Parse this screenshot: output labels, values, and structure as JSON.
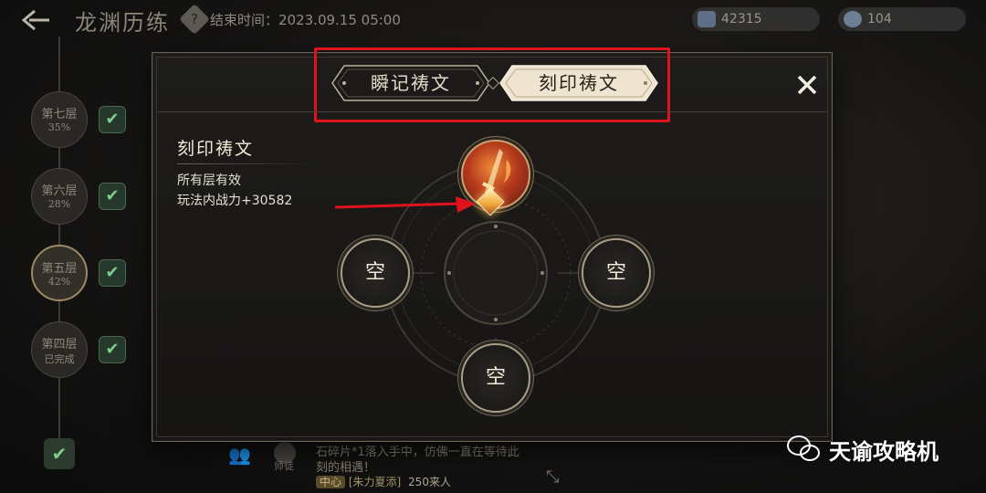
{
  "topbar": {
    "back_icon": "back-arrow-icon",
    "title": "龙渊历练",
    "help_icon": "?",
    "end_time": "结束时间：2023.09.15 05:00",
    "resources": [
      {
        "icon": "ticket-icon",
        "value": "42315"
      },
      {
        "icon": "orb-icon",
        "value": "104"
      }
    ]
  },
  "floors": [
    {
      "name": "第七层",
      "progress": "35%"
    },
    {
      "name": "第六层",
      "progress": "28%"
    },
    {
      "name": "第五层",
      "progress": "42%"
    },
    {
      "name": "第四层",
      "progress": "已完成"
    }
  ],
  "bottom": {
    "note_line1": "石碎片*1落入手中，仿佛一直在等待此",
    "note_line2": "刻的相遇！",
    "cert_label": "师徒",
    "chip": "中心",
    "chip_user": "[朱力夏添]",
    "count": "250来人"
  },
  "modal": {
    "tabs": [
      {
        "label": "瞬记祷文",
        "selected": false
      },
      {
        "label": "刻印祷文",
        "selected": true
      }
    ],
    "close_icon": "✕",
    "info": {
      "title": "刻印祷文",
      "line1": "所有层有效",
      "line2": "玩法内战力+30582"
    },
    "slots": {
      "top": {
        "state": "filled",
        "icon": "flame-sword-rune-icon"
      },
      "left": {
        "label": "空"
      },
      "right": {
        "label": "空"
      },
      "bottom": {
        "label": "空"
      }
    }
  },
  "watermark": {
    "icon": "wechat-icon",
    "text": "天谕攻略机"
  },
  "colors": {
    "annotation_red": "#e0121c",
    "selected_tab_bg": "#efe4d0",
    "gold_border": "#a99d83"
  }
}
